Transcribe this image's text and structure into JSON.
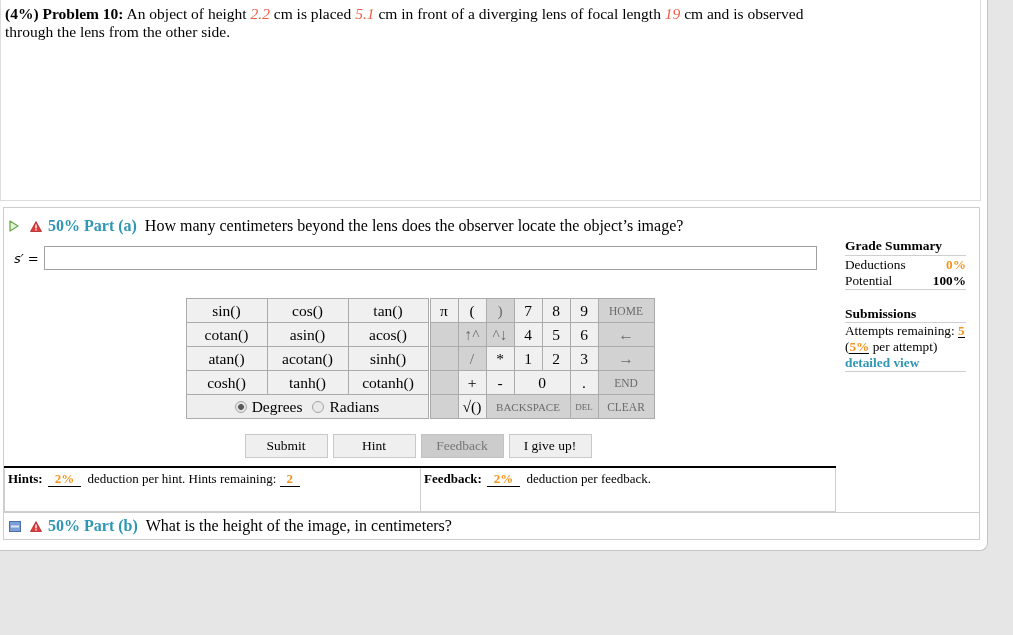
{
  "problem": {
    "text": "**(4%) Problem 10:** An object of height *2.2* cm is placed *5.1* cm in front of a diverging lens of focal length *19* cm and is observed through the lens from the other side."
  },
  "parts": [
    {
      "expanded": true,
      "title": "50% Part (a)",
      "question": "How many centimeters beyond the lens does the observer locate the object’s image?",
      "answer": {
        "label": "*s′* ="
      },
      "keypad": {
        "functions": [
          "sin()",
          "cos()",
          "tan()",
          "cotan()",
          "asin()",
          "acos()",
          "atan()",
          "acotan()",
          "sinh()",
          "cosh()",
          "tanh()",
          "cotanh()"
        ],
        "angle_mode": [
          {
            "label": "Degrees",
            "selected": true
          },
          {
            "label": "Radians",
            "selected": false
          }
        ],
        "keys": [
          {
            "label": "π",
            "kind": "key",
            "disabled": false
          },
          {
            "label": "(",
            "kind": "key",
            "disabled": false
          },
          {
            "label": ")",
            "kind": "key",
            "disabled": true
          },
          {
            "label": "7",
            "kind": "key",
            "disabled": false
          },
          {
            "label": "8",
            "kind": "key",
            "disabled": false
          },
          {
            "label": "9",
            "kind": "key",
            "disabled": false
          },
          {
            "label": "HOME",
            "kind": "word",
            "disabled": true
          },
          {
            "kind": "blank",
            "disabled": true
          },
          {
            "label": "↑^",
            "kind": "key",
            "disabled": true
          },
          {
            "label": "^↓",
            "kind": "key",
            "disabled": true
          },
          {
            "label": "4",
            "kind": "key",
            "disabled": false
          },
          {
            "label": "5",
            "kind": "key",
            "disabled": false
          },
          {
            "label": "6",
            "kind": "key",
            "disabled": false
          },
          {
            "label": "←",
            "kind": "key",
            "disabled": true
          },
          {
            "kind": "blank",
            "disabled": true
          },
          {
            "label": "/",
            "kind": "key",
            "disabled": true
          },
          {
            "label": "*",
            "kind": "key",
            "disabled": false
          },
          {
            "label": "1",
            "kind": "key",
            "disabled": false
          },
          {
            "label": "2",
            "kind": "key",
            "disabled": false
          },
          {
            "label": "3",
            "kind": "key",
            "disabled": false
          },
          {
            "label": "→",
            "kind": "key",
            "disabled": true
          },
          {
            "kind": "blank",
            "disabled": true
          },
          {
            "label": "+",
            "kind": "key",
            "disabled": false
          },
          {
            "label": "-",
            "kind": "key",
            "disabled": false
          },
          {
            "label": "0",
            "kind": "wide",
            "disabled": false
          },
          {
            "label": ".",
            "kind": "key",
            "disabled": false
          },
          {
            "label": "END",
            "kind": "word",
            "disabled": true
          },
          {
            "kind": "blank",
            "disabled": true
          },
          {
            "label": "√()",
            "kind": "key",
            "disabled": false
          },
          {
            "label": "BACKSPACE",
            "kind": "long",
            "disabled": true
          },
          {
            "label": "DEL",
            "kind": "tiny",
            "disabled": true
          },
          {
            "label": "CLEAR",
            "kind": "word",
            "disabled": true
          }
        ]
      },
      "buttons": [
        {
          "label": "Submit",
          "disabled": false
        },
        {
          "label": "Hint",
          "disabled": false
        },
        {
          "label": "Feedback",
          "disabled": true
        },
        {
          "label": "I give up!",
          "disabled": false
        }
      ],
      "hints": {
        "label": "Hints:",
        "text": "**2%** deduction per hint. Hints remaining: **2**"
      },
      "feedback": {
        "label": "Feedback:",
        "text": "**2%** deduction per feedback."
      },
      "grade_summary": {
        "title": "Grade Summary",
        "rows": [
          {
            "label": "Deductions",
            "value": "0%",
            "color": "#f7941d"
          },
          {
            "label": "Potential",
            "value": "100%",
            "color": "#000000"
          }
        ]
      },
      "submissions": {
        "title": "Submissions",
        "attempts": "Attempts remaining: **5**",
        "penalty": "(**5%** per attempt)",
        "link": "detailed view"
      }
    },
    {
      "expanded": false,
      "title": "50% Part (b)",
      "question": "What is the height of the image, in centimeters?"
    }
  ]
}
